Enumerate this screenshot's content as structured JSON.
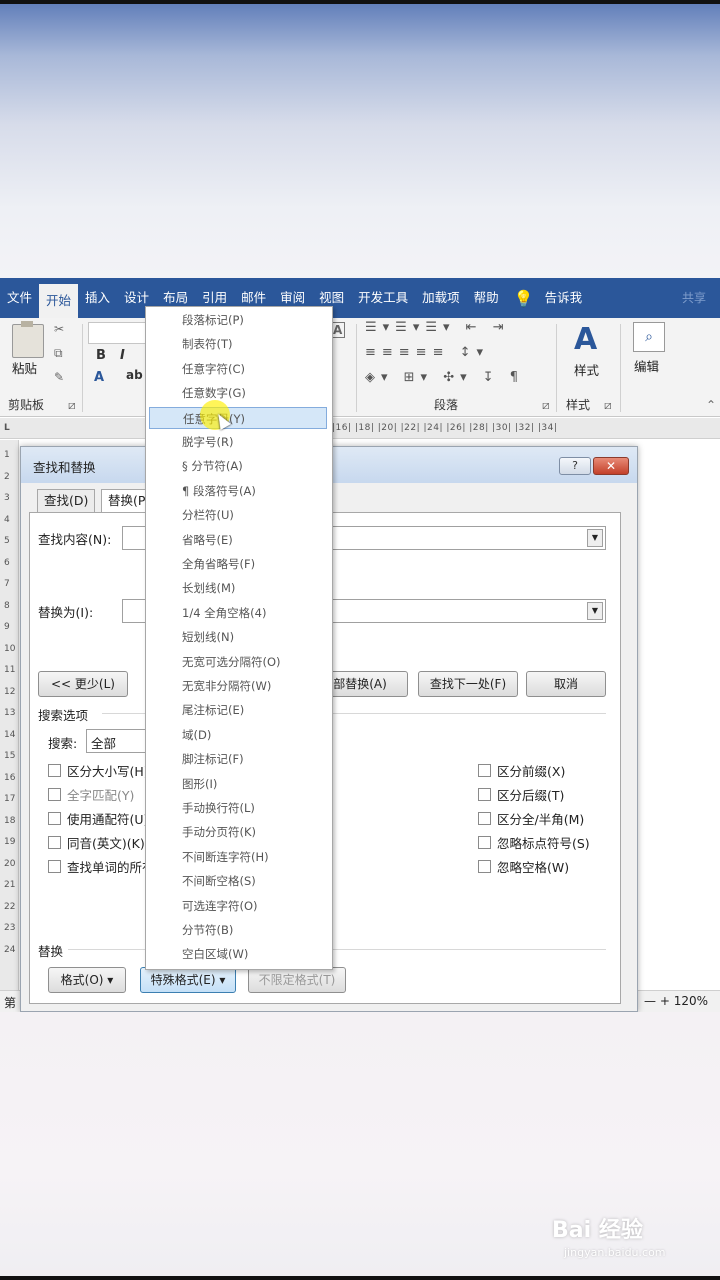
{
  "ribbon": {
    "tabs": [
      "文件",
      "开始",
      "插入",
      "设计",
      "布局",
      "引用",
      "邮件",
      "审阅",
      "视图",
      "开发工具",
      "加载项",
      "帮助"
    ],
    "active_tab_index": 1,
    "tell_me": "告诉我",
    "share": "共享",
    "paste_label": "粘贴",
    "clipboard_group": "剪贴板",
    "paragraph_group": "段落",
    "styles_group": "样式",
    "styles_label": "样式",
    "editing_label": "编辑"
  },
  "ruler": {
    "numbers": "|16|  |18|  |20|  |22|  |24|  |26|  |28|  |30|  |32|  |34|",
    "vertical": [
      "1",
      "2",
      "3",
      "4",
      "5",
      "6",
      "7",
      "8",
      "9",
      "10",
      "11",
      "12",
      "13",
      "14",
      "15",
      "16",
      "17",
      "18",
      "19",
      "20",
      "21",
      "22",
      "23",
      "24"
    ]
  },
  "statusbar": {
    "page": "第",
    "zoom": "120%"
  },
  "dialog": {
    "title": "查找和替换",
    "tabs": [
      "查找(D)",
      "替换(P)"
    ],
    "find_label": "查找内容(N):",
    "replace_label": "替换为(I):",
    "less_button": "<< 更少(L)",
    "replace_all_button": "全部替换(A)",
    "find_next_button": "查找下一处(F)",
    "cancel_button": "取消",
    "search_options": "搜索选项",
    "search_label": "搜索:",
    "search_value": "全部",
    "options_left": [
      "区分大小写(H)",
      "全字匹配(Y)",
      "使用通配符(U)",
      "同音(英文)(K)",
      "查找单词的所有形式(英文)(W)"
    ],
    "options_right": [
      "区分前缀(X)",
      "区分后缀(T)",
      "区分全/半角(M)",
      "忽略标点符号(S)",
      "忽略空格(W)"
    ],
    "replace_section": "替换",
    "format_button": "格式(O) ▾",
    "special_button": "特殊格式(E) ▾",
    "no_format_button": "不限定格式(T)"
  },
  "special_menu": {
    "items": [
      "段落标记(P)",
      "制表符(T)",
      "任意字符(C)",
      "任意数字(G)",
      "任意字母(Y)",
      "脱字号(R)",
      "§ 分节符(A)",
      "¶ 段落符号(A)",
      "分栏符(U)",
      "省略号(E)",
      "全角省略号(F)",
      "长划线(M)",
      "1/4 全角空格(4)",
      "短划线(N)",
      "无宽可选分隔符(O)",
      "无宽非分隔符(W)",
      "尾注标记(E)",
      "域(D)",
      "脚注标记(F)",
      "图形(I)",
      "手动换行符(L)",
      "手动分页符(K)",
      "不间断连字符(H)",
      "不间断空格(S)",
      "可选连字符(O)",
      "分节符(B)",
      "空白区域(W)"
    ],
    "hovered_index": 4
  },
  "watermark": {
    "brand": "Bai 经验",
    "url": "jingyan.baidu.com"
  }
}
